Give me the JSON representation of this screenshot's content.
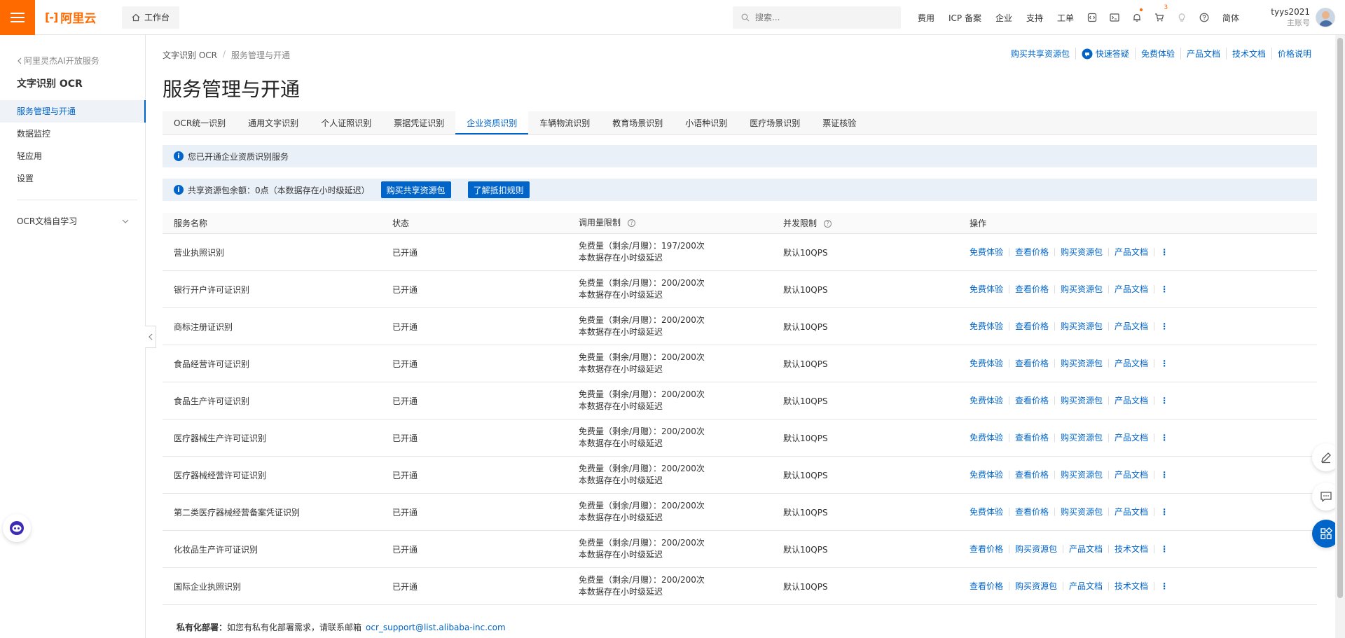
{
  "topbar": {
    "brand": "阿里云",
    "workbench": "工作台",
    "search_placeholder": "搜索...",
    "links": [
      "费用",
      "ICP 备案",
      "企业",
      "支持",
      "工单"
    ],
    "cart_badge": "3",
    "lang": "简体",
    "user_name": "tyys2021",
    "user_role": "主账号"
  },
  "sidebar": {
    "back_label": "阿里灵杰AI开放服务",
    "product_title": "文字识别 OCR",
    "items": [
      {
        "label": "服务管理与开通"
      },
      {
        "label": "数据监控"
      },
      {
        "label": "轻应用"
      },
      {
        "label": "设置"
      }
    ],
    "group_label": "OCR文档自学习"
  },
  "breadcrumb": {
    "root": "文字识别 OCR",
    "current": "服务管理与开通"
  },
  "header_links": [
    "购买共享资源包",
    "快速答疑",
    "免费体验",
    "产品文档",
    "技术文档",
    "价格说明"
  ],
  "page_title": "服务管理与开通",
  "tabs": [
    "OCR统一识别",
    "通用文字识别",
    "个人证照识别",
    "票据凭证识别",
    "企业资质识别",
    "车辆物流识别",
    "教育场景识别",
    "小语种识别",
    "医疗场景识别",
    "票证核验"
  ],
  "active_tab": "企业资质识别",
  "notice": "您已开通企业资质识别服务",
  "quota": {
    "text": "共享资源包余额：0点（本数据存在小时级延迟）",
    "buy_button": "购买共享资源包",
    "rules_button": "了解抵扣规则"
  },
  "table": {
    "headers": [
      "服务名称",
      "状态",
      "调用量限制",
      "并发限制",
      "操作"
    ],
    "rows": [
      {
        "name": "营业执照识别",
        "status": "已开通",
        "quota1": "免费量（剩余/月赠）：197/200次",
        "quota2": "本数据存在小时级延迟",
        "qps": "默认10QPS",
        "ops": [
          "免费体验",
          "查看价格",
          "购买资源包",
          "产品文档"
        ]
      },
      {
        "name": "银行开户许可证识别",
        "status": "已开通",
        "quota1": "免费量（剩余/月赠）：200/200次",
        "quota2": "本数据存在小时级延迟",
        "qps": "默认10QPS",
        "ops": [
          "免费体验",
          "查看价格",
          "购买资源包",
          "产品文档"
        ]
      },
      {
        "name": "商标注册证识别",
        "status": "已开通",
        "quota1": "免费量（剩余/月赠）：200/200次",
        "quota2": "本数据存在小时级延迟",
        "qps": "默认10QPS",
        "ops": [
          "免费体验",
          "查看价格",
          "购买资源包",
          "产品文档"
        ]
      },
      {
        "name": "食品经营许可证识别",
        "status": "已开通",
        "quota1": "免费量（剩余/月赠）：200/200次",
        "quota2": "本数据存在小时级延迟",
        "qps": "默认10QPS",
        "ops": [
          "免费体验",
          "查看价格",
          "购买资源包",
          "产品文档"
        ]
      },
      {
        "name": "食品生产许可证识别",
        "status": "已开通",
        "quota1": "免费量（剩余/月赠）：200/200次",
        "quota2": "本数据存在小时级延迟",
        "qps": "默认10QPS",
        "ops": [
          "免费体验",
          "查看价格",
          "购买资源包",
          "产品文档"
        ]
      },
      {
        "name": "医疗器械生产许可证识别",
        "status": "已开通",
        "quota1": "免费量（剩余/月赠）：200/200次",
        "quota2": "本数据存在小时级延迟",
        "qps": "默认10QPS",
        "ops": [
          "免费体验",
          "查看价格",
          "购买资源包",
          "产品文档"
        ]
      },
      {
        "name": "医疗器械经营许可证识别",
        "status": "已开通",
        "quota1": "免费量（剩余/月赠）：200/200次",
        "quota2": "本数据存在小时级延迟",
        "qps": "默认10QPS",
        "ops": [
          "免费体验",
          "查看价格",
          "购买资源包",
          "产品文档"
        ]
      },
      {
        "name": "第二类医疗器械经营备案凭证识别",
        "status": "已开通",
        "quota1": "免费量（剩余/月赠）：200/200次",
        "quota2": "本数据存在小时级延迟",
        "qps": "默认10QPS",
        "ops": [
          "免费体验",
          "查看价格",
          "购买资源包",
          "产品文档"
        ]
      },
      {
        "name": "化妆品生产许可证识别",
        "status": "已开通",
        "quota1": "免费量（剩余/月赠）：200/200次",
        "quota2": "本数据存在小时级延迟",
        "qps": "默认10QPS",
        "ops": [
          "查看价格",
          "购买资源包",
          "产品文档",
          "技术文档"
        ]
      },
      {
        "name": "国际企业执照识别",
        "status": "已开通",
        "quota1": "免费量（剩余/月赠）：200/200次",
        "quota2": "本数据存在小时级延迟",
        "qps": "默认10QPS",
        "ops": [
          "查看价格",
          "购买资源包",
          "产品文档",
          "技术文档"
        ]
      }
    ]
  },
  "footer": {
    "label": "私有化部署：",
    "text": "如您有私有化部署需求，请联系邮箱",
    "email": "ocr_support@list.alibaba-inc.com"
  },
  "colors": {
    "brand": "#ff6a00",
    "primary": "#0064c8"
  }
}
